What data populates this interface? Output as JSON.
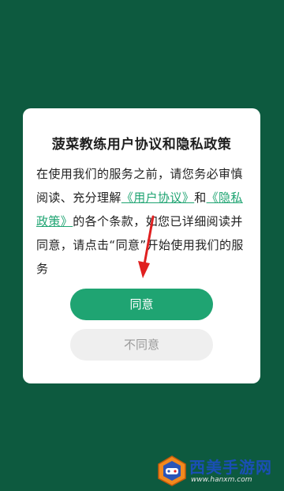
{
  "dialog": {
    "title": "菠菜教练用户协议和隐私政策",
    "body_prefix": "在使用我们的服务之前，请您务必审慎阅读、充分理解",
    "user_agreement_link": "《用户协议》",
    "and_text": "和",
    "privacy_policy_link": "《隐私政策》",
    "body_suffix": "的各个条款，如您已详细阅读并同意，请点击“同意”开始使用我们的服务",
    "agree_label": "同意",
    "disagree_label": "不同意"
  },
  "watermark": {
    "brand_text": "西美手游网",
    "url_text": "www.hanxm.com"
  },
  "colors": {
    "background": "#0d5a3f",
    "accent": "#1fa472",
    "arrow": "#e02020"
  }
}
